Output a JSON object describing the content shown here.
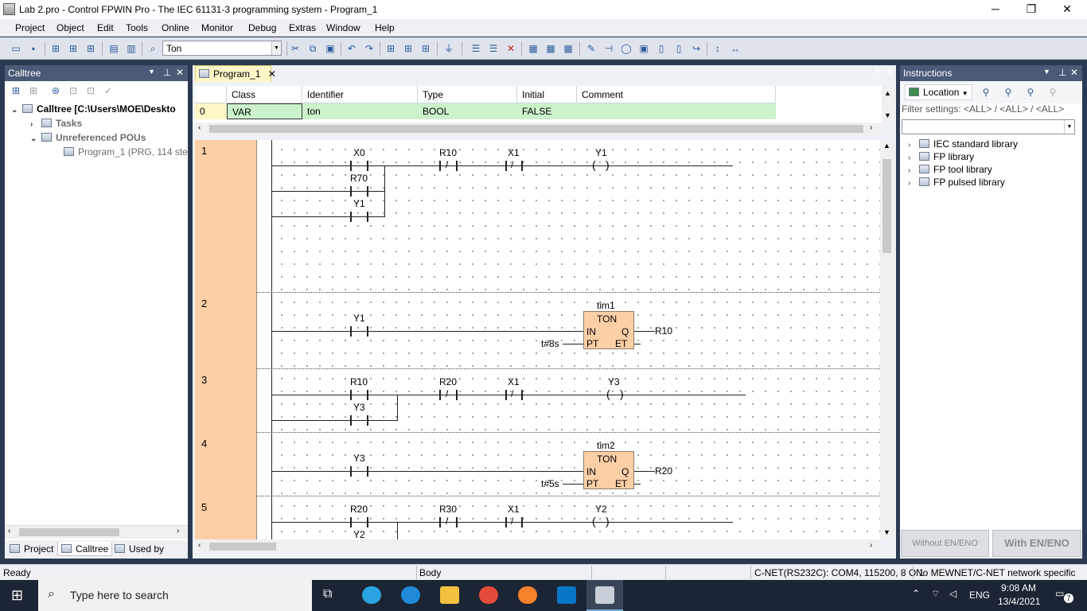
{
  "window": {
    "title": "Lab 2.pro - Control FPWIN Pro - The IEC 61131-3 programming system - Program_1",
    "minimize": "─",
    "restore": "❐",
    "close": "✕"
  },
  "menu": [
    "Project",
    "Object",
    "Edit",
    "Tools",
    "Online",
    "Monitor",
    "Debug",
    "Extras",
    "Window",
    "Help"
  ],
  "toolbar": {
    "search_value": "Ton"
  },
  "calltree": {
    "title": "Calltree",
    "root": "Calltree [C:\\Users\\MOE\\Deskto",
    "tasks": "Tasks",
    "unref": "Unreferenced POUs",
    "program": "Program_1 (PRG, 114 ste"
  },
  "left_tabs": [
    "Project",
    "Calltree",
    "Used by"
  ],
  "doc_tab": {
    "label": "Program_1",
    "close": "✕"
  },
  "vars": {
    "headers": [
      "Class",
      "Identifier",
      "Type",
      "Initial",
      "Comment"
    ],
    "rows": [
      {
        "num": "0",
        "class": "VAR",
        "identifier": "ton",
        "type": "BOOL",
        "initial": "FALSE",
        "comment": ""
      }
    ]
  },
  "rungs": [
    {
      "num": "1",
      "contacts": [
        "X0",
        "R70",
        "Y1",
        "R10",
        "X1"
      ],
      "coil": "Y1"
    },
    {
      "num": "2",
      "contacts": [
        "Y1"
      ],
      "fb_name": "tim1",
      "fb_type": "TON",
      "pin_in": "IN",
      "pin_q": "Q",
      "pin_pt": "PT",
      "pin_et": "ET",
      "pt_value": "t#8s",
      "q_out": "R10"
    },
    {
      "num": "3",
      "contacts": [
        "R10",
        "Y3",
        "R20",
        "X1"
      ],
      "coil": "Y3"
    },
    {
      "num": "4",
      "contacts": [
        "Y3"
      ],
      "fb_name": "tim2",
      "fb_type": "TON",
      "pin_in": "IN",
      "pin_q": "Q",
      "pin_pt": "PT",
      "pin_et": "ET",
      "pt_value": "t#5s",
      "q_out": "R20"
    },
    {
      "num": "5",
      "contacts": [
        "R20",
        "Y2",
        "R30",
        "X1"
      ],
      "coil": "Y2"
    }
  ],
  "instructions": {
    "title": "Instructions",
    "location": "Location",
    "filter": "Filter settings: <ALL> / <ALL> / <ALL>",
    "libs": [
      "IEC standard library",
      "FP library",
      "FP tool library",
      "FP pulsed library"
    ],
    "btn_without": "Without EN/ENO",
    "btn_with": "With EN/ENO"
  },
  "status": {
    "ready": "Ready",
    "body": "Body",
    "conn": "C-NET(RS232C): COM4, 115200, 8 O 1",
    "network": "No MEWNET/C-NET network specific"
  },
  "taskbar": {
    "search": "Type here to search",
    "lang": "ENG",
    "time": "9:08 AM",
    "date": "13/4/2021",
    "notifications": "7"
  }
}
